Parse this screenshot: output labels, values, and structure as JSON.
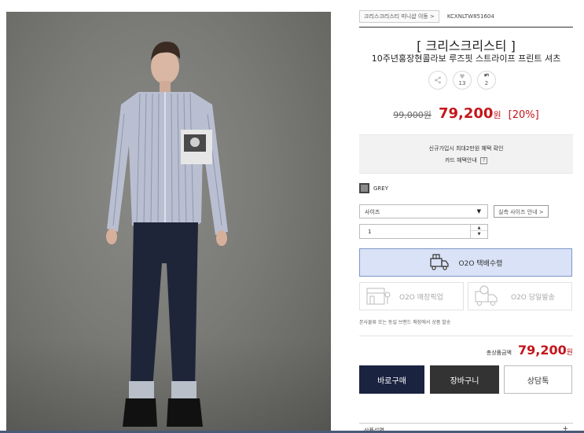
{
  "breadcrumb": {
    "minishop_link": "크리스크리스티 미니샵 이동 >",
    "product_code": "KCXNLTW851604"
  },
  "product": {
    "brand": "[ 크리스크리스티 ]",
    "title": "10주년홍장현콜라보 루즈핏 스트라이프 프린트 셔츠"
  },
  "social": {
    "share_icon": "share-icon",
    "like_count": "13",
    "review_count": "2"
  },
  "price": {
    "original": "99,000원",
    "sale": "79,200",
    "currency": "원",
    "discount": "[20%]"
  },
  "benefit": {
    "line1": "신규가입시 최대2만원 혜택 확인",
    "line2": "카드 혜택안내",
    "help": "?"
  },
  "color": {
    "label": "GREY",
    "swatch": "#8a8a8a"
  },
  "size": {
    "placeholder": "사이즈",
    "guide_button": "실측 사이즈 안내 >"
  },
  "quantity": {
    "value": "1"
  },
  "o2o": {
    "delivery": "O2O 택배수령",
    "store_pickup": "O2O 매장픽업",
    "same_day": "O2O 당일발송",
    "note": "본사물류 또는 동일 브랜드 매장에서 상품 발송"
  },
  "total": {
    "label": "총상품금액",
    "amount": "79,200",
    "currency": "원"
  },
  "buttons": {
    "buy": "바로구매",
    "cart": "장바구니",
    "consult": "상담톡"
  },
  "bottom": {
    "tab": "상품설명",
    "plus": "+"
  },
  "colors": {
    "sale_red": "#c4161c",
    "navy": "#1a2340",
    "o2o_blue": "#d9e2f6"
  }
}
